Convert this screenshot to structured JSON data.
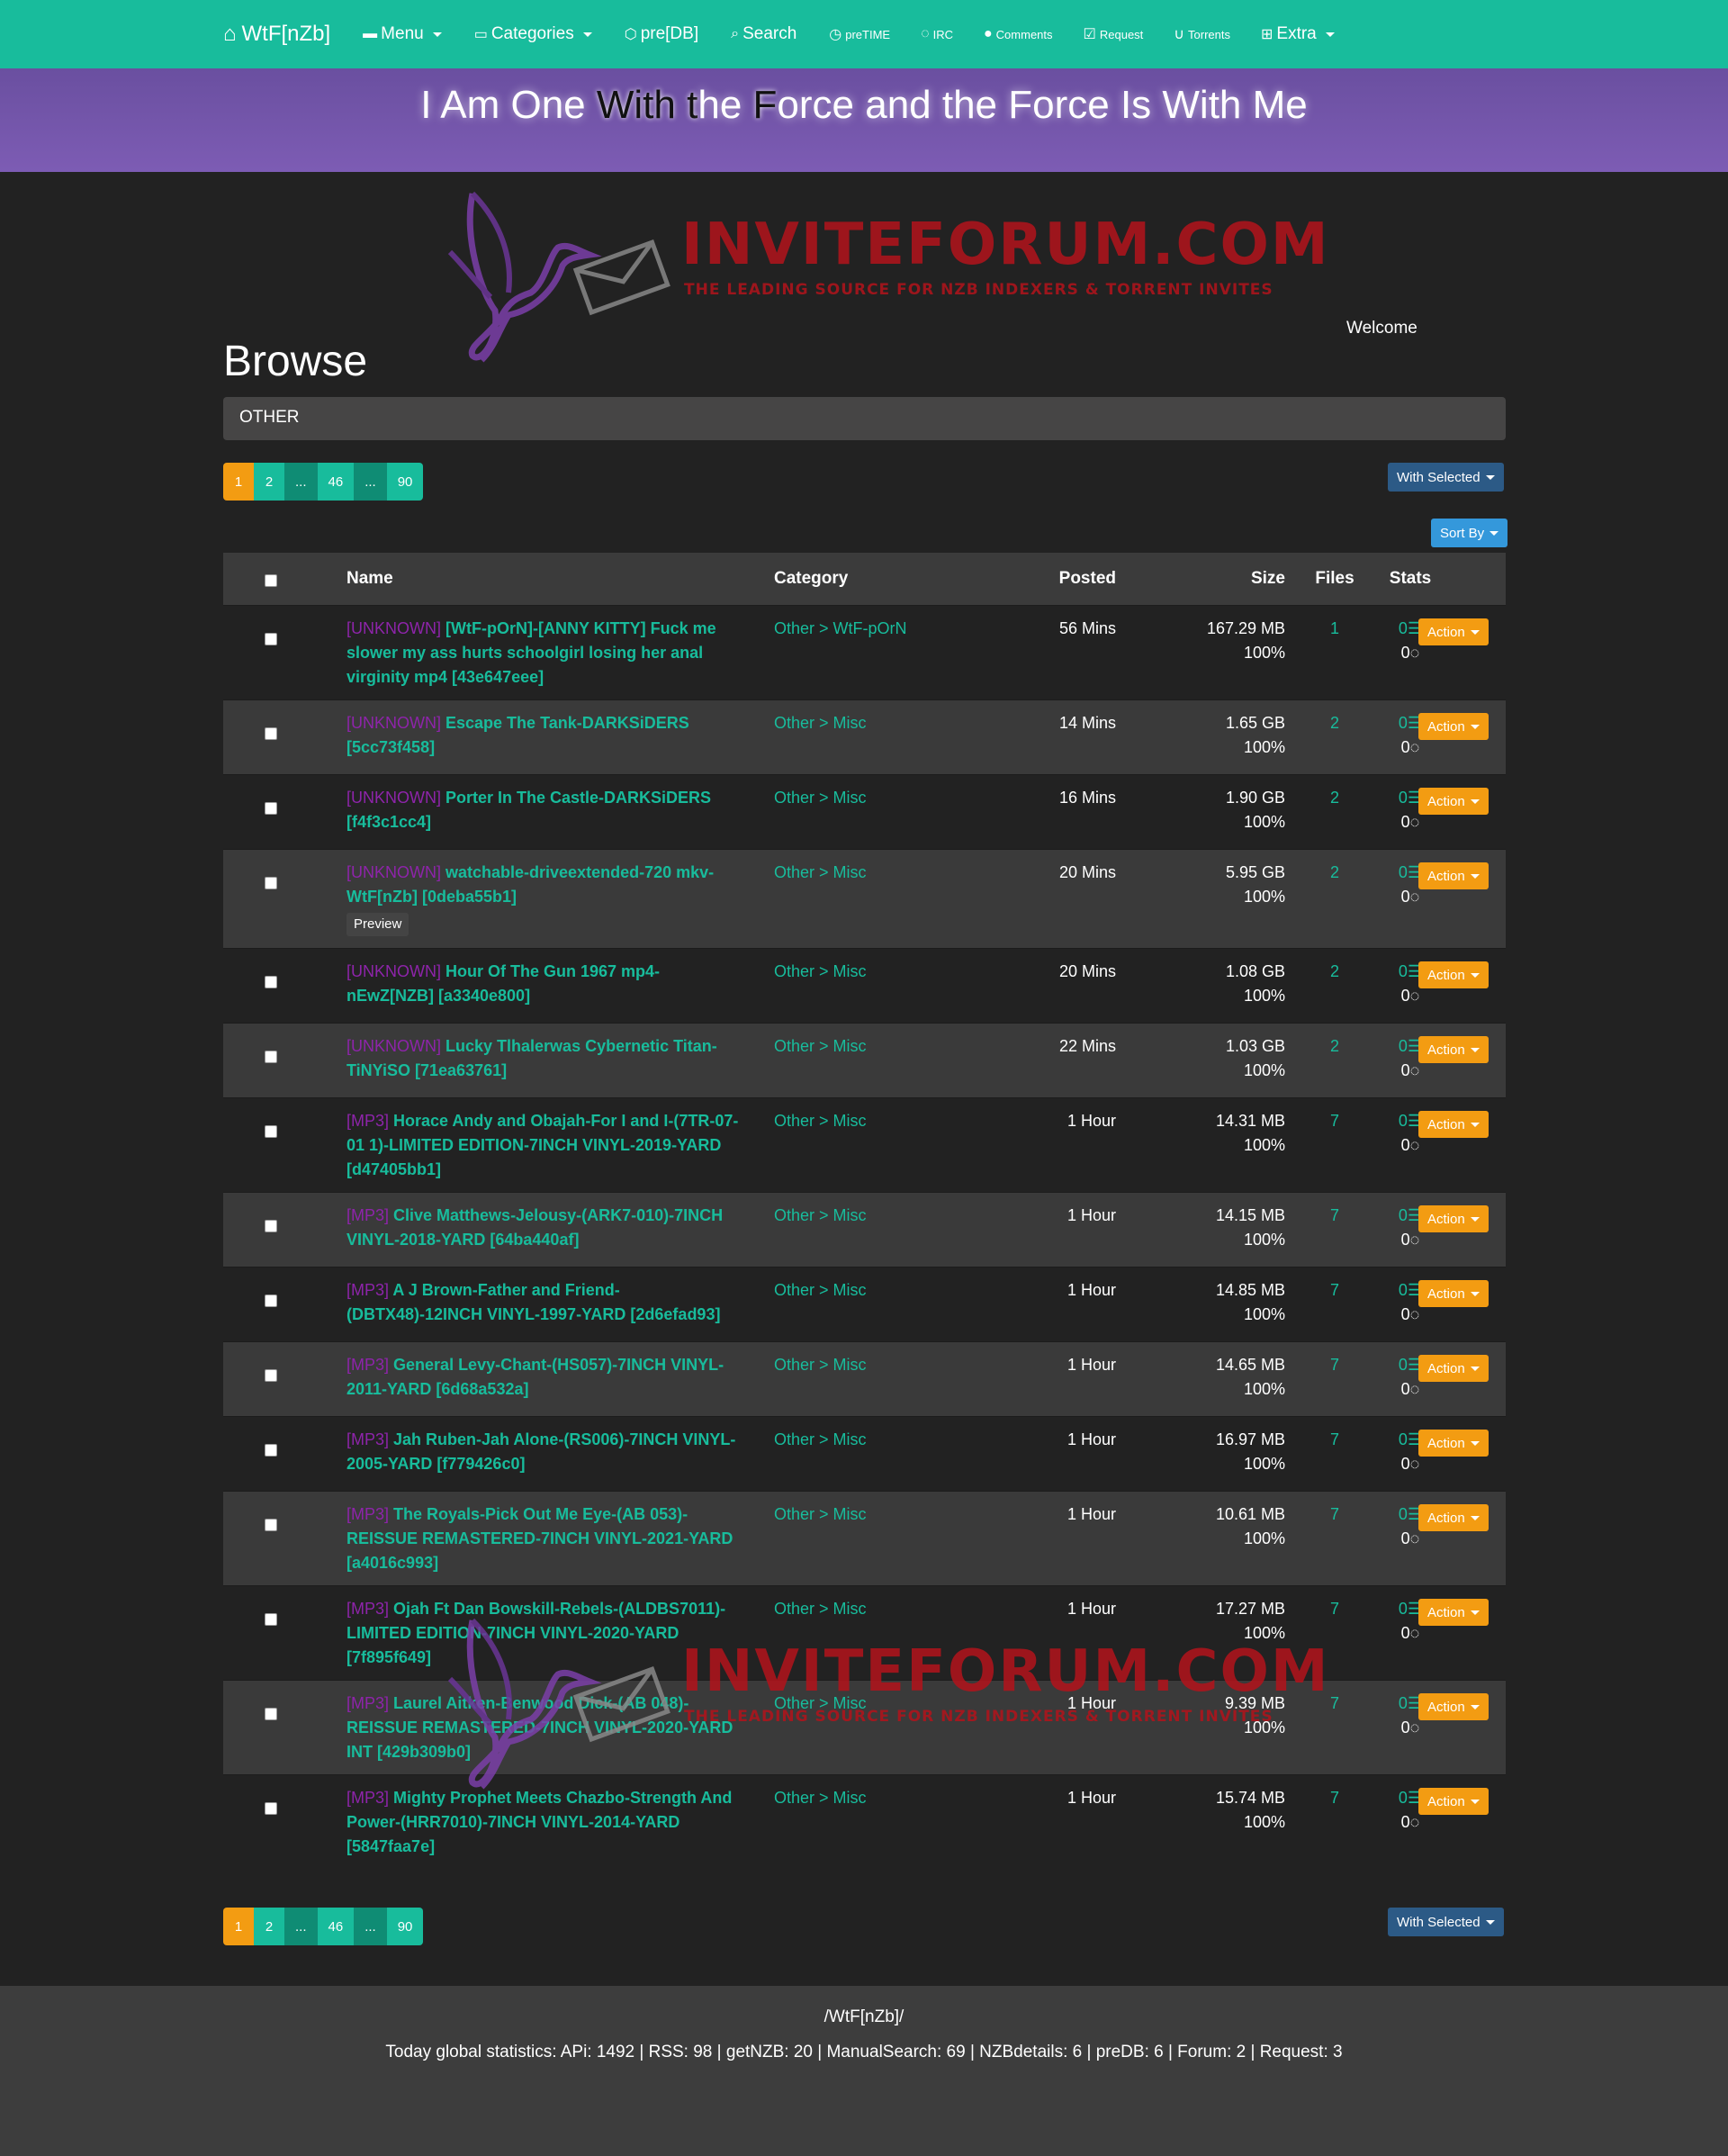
{
  "navbar": {
    "brand": "WtF[nZb]",
    "items": [
      {
        "label": "Menu",
        "icon": "folder-icon",
        "dropdown": true
      },
      {
        "label": "Categories",
        "icon": "folder-open-icon",
        "dropdown": true
      },
      {
        "label": "pre[DB]",
        "icon": "database-icon",
        "dropdown": false
      },
      {
        "label": "Search",
        "icon": "search-icon",
        "dropdown": false
      },
      {
        "label": "preTIME",
        "icon": "clock-icon",
        "dropdown": false
      },
      {
        "label": "IRC",
        "icon": "chat-icon",
        "dropdown": false
      },
      {
        "label": "Comments",
        "icon": "comments-icon",
        "dropdown": false
      },
      {
        "label": "Request",
        "icon": "check-square-icon",
        "dropdown": false
      },
      {
        "label": "Torrents",
        "icon": "magnet-icon",
        "dropdown": false
      },
      {
        "label": "Extra",
        "icon": "sitemap-icon",
        "dropdown": true
      }
    ]
  },
  "banner": {
    "part1": "I Am One ",
    "part2": "With",
    "part3": " ",
    "part4": "t",
    "part5": "he ",
    "part6": "F",
    "part7": "orce and the Force Is With Me"
  },
  "watermark": {
    "title": "INVITEFORUM.COM",
    "subtitle": "THE LEADING SOURCE FOR NZB INDEXERS & TORRENT INVITES"
  },
  "welcome": "Welcome",
  "page_title": "Browse",
  "breadcrumb": "OTHER",
  "pagination": [
    "1",
    "2",
    "...",
    "46",
    "...",
    "90"
  ],
  "with_selected": "With Selected",
  "sort_by": "Sort By",
  "table": {
    "headers": {
      "name": "Name",
      "category": "Category",
      "posted": "Posted",
      "size": "Size",
      "files": "Files",
      "stats": "Stats"
    },
    "action_label": "Action",
    "preview_label": "Preview",
    "rows": [
      {
        "tag": "[UNKNOWN]",
        "name": "[WtF-pOrN]-[ANNY KITTY] Fuck me slower my ass hurts schoolgirl losing her anal virginity mp4 [43e647eee]",
        "category": "Other > WtF-pOrN",
        "posted": "56 Mins",
        "size": "167.29 MB",
        "pct": "100%",
        "files": "1",
        "grabs": "0",
        "comments": "0"
      },
      {
        "tag": "[UNKNOWN]",
        "name": "Escape The Tank-DARKSiDERS [5cc73f458]",
        "category": "Other > Misc",
        "posted": "14 Mins",
        "size": "1.65 GB",
        "pct": "100%",
        "files": "2",
        "grabs": "0",
        "comments": "0"
      },
      {
        "tag": "[UNKNOWN]",
        "name": "Porter In The Castle-DARKSiDERS [f4f3c1cc4]",
        "category": "Other > Misc",
        "posted": "16 Mins",
        "size": "1.90 GB",
        "pct": "100%",
        "files": "2",
        "grabs": "0",
        "comments": "0"
      },
      {
        "tag": "[UNKNOWN]",
        "name": "watchable-driveextended-720 mkv-WtF[nZb] [0deba55b1]",
        "category": "Other > Misc",
        "posted": "20 Mins",
        "size": "5.95 GB",
        "pct": "100%",
        "files": "2",
        "grabs": "0",
        "comments": "0",
        "preview": true
      },
      {
        "tag": "[UNKNOWN]",
        "name": "Hour Of The Gun 1967 mp4-nEwZ[NZB] [a3340e800]",
        "category": "Other > Misc",
        "posted": "20 Mins",
        "size": "1.08 GB",
        "pct": "100%",
        "files": "2",
        "grabs": "0",
        "comments": "0"
      },
      {
        "tag": "[UNKNOWN]",
        "name": "Lucky Tlhalerwas Cybernetic Titan-TiNYiSO [71ea63761]",
        "category": "Other > Misc",
        "posted": "22 Mins",
        "size": "1.03 GB",
        "pct": "100%",
        "files": "2",
        "grabs": "0",
        "comments": "0"
      },
      {
        "tag": "[MP3]",
        "name": "Horace Andy and Obajah-For I and I-(7TR-07-01 1)-LIMITED EDITION-7INCH VINYL-2019-YARD [d47405bb1]",
        "category": "Other > Misc",
        "posted": "1 Hour",
        "size": "14.31 MB",
        "pct": "100%",
        "files": "7",
        "grabs": "0",
        "comments": "0"
      },
      {
        "tag": "[MP3]",
        "name": "Clive Matthews-Jelousy-(ARK7-010)-7INCH VINYL-2018-YARD [64ba440af]",
        "category": "Other > Misc",
        "posted": "1 Hour",
        "size": "14.15 MB",
        "pct": "100%",
        "files": "7",
        "grabs": "0",
        "comments": "0"
      },
      {
        "tag": "[MP3]",
        "name": "A J Brown-Father and Friend-(DBTX48)-12INCH VINYL-1997-YARD [2d6efad93]",
        "category": "Other > Misc",
        "posted": "1 Hour",
        "size": "14.85 MB",
        "pct": "100%",
        "files": "7",
        "grabs": "0",
        "comments": "0"
      },
      {
        "tag": "[MP3]",
        "name": "General Levy-Chant-(HS057)-7INCH VINYL-2011-YARD [6d68a532a]",
        "category": "Other > Misc",
        "posted": "1 Hour",
        "size": "14.65 MB",
        "pct": "100%",
        "files": "7",
        "grabs": "0",
        "comments": "0"
      },
      {
        "tag": "[MP3]",
        "name": "Jah Ruben-Jah Alone-(RS006)-7INCH VINYL-2005-YARD [f779426c0]",
        "category": "Other > Misc",
        "posted": "1 Hour",
        "size": "16.97 MB",
        "pct": "100%",
        "files": "7",
        "grabs": "0",
        "comments": "0"
      },
      {
        "tag": "[MP3]",
        "name": "The Royals-Pick Out Me Eye-(AB 053)-REISSUE REMASTERED-7INCH VINYL-2021-YARD [a4016c993]",
        "category": "Other > Misc",
        "posted": "1 Hour",
        "size": "10.61 MB",
        "pct": "100%",
        "files": "7",
        "grabs": "0",
        "comments": "0"
      },
      {
        "tag": "[MP3]",
        "name": "Ojah Ft Dan Bowskill-Rebels-(ALDBS7011)-LIMITED EDITION-7INCH VINYL-2020-YARD [7f895f649]",
        "category": "Other > Misc",
        "posted": "1 Hour",
        "size": "17.27 MB",
        "pct": "100%",
        "files": "7",
        "grabs": "0",
        "comments": "0"
      },
      {
        "tag": "[MP3]",
        "name": "Laurel Aitken-Benwood Dick-(AB 048)-REISSUE REMASTERED-7INCH VINYL-2020-YARD INT [429b309b0]",
        "category": "Other > Misc",
        "posted": "1 Hour",
        "size": "9.39 MB",
        "pct": "100%",
        "files": "7",
        "grabs": "0",
        "comments": "0"
      },
      {
        "tag": "[MP3]",
        "name": "Mighty Prophet Meets Chazbo-Strength And Power-(HRR7010)-7INCH VINYL-2014-YARD [5847faa7e]",
        "category": "Other > Misc",
        "posted": "1 Hour",
        "size": "15.74 MB",
        "pct": "100%",
        "files": "7",
        "grabs": "0",
        "comments": "0"
      }
    ]
  },
  "footer": {
    "site": "/WtF[nZb]/",
    "stats_label": "Today global statistics:",
    "stats": "APi: 1492 | RSS: 98 | getNZB: 20 | ManualSearch: 69 | NZBdetails: 6 | preDB: 6 | Forum: 2 | Request: 3"
  },
  "colors": {
    "accent": "#18bc9c",
    "warning": "#f39c12",
    "banner": "#7d5cb4",
    "tag": "#8e24aa",
    "watermark": "#b3131b"
  }
}
